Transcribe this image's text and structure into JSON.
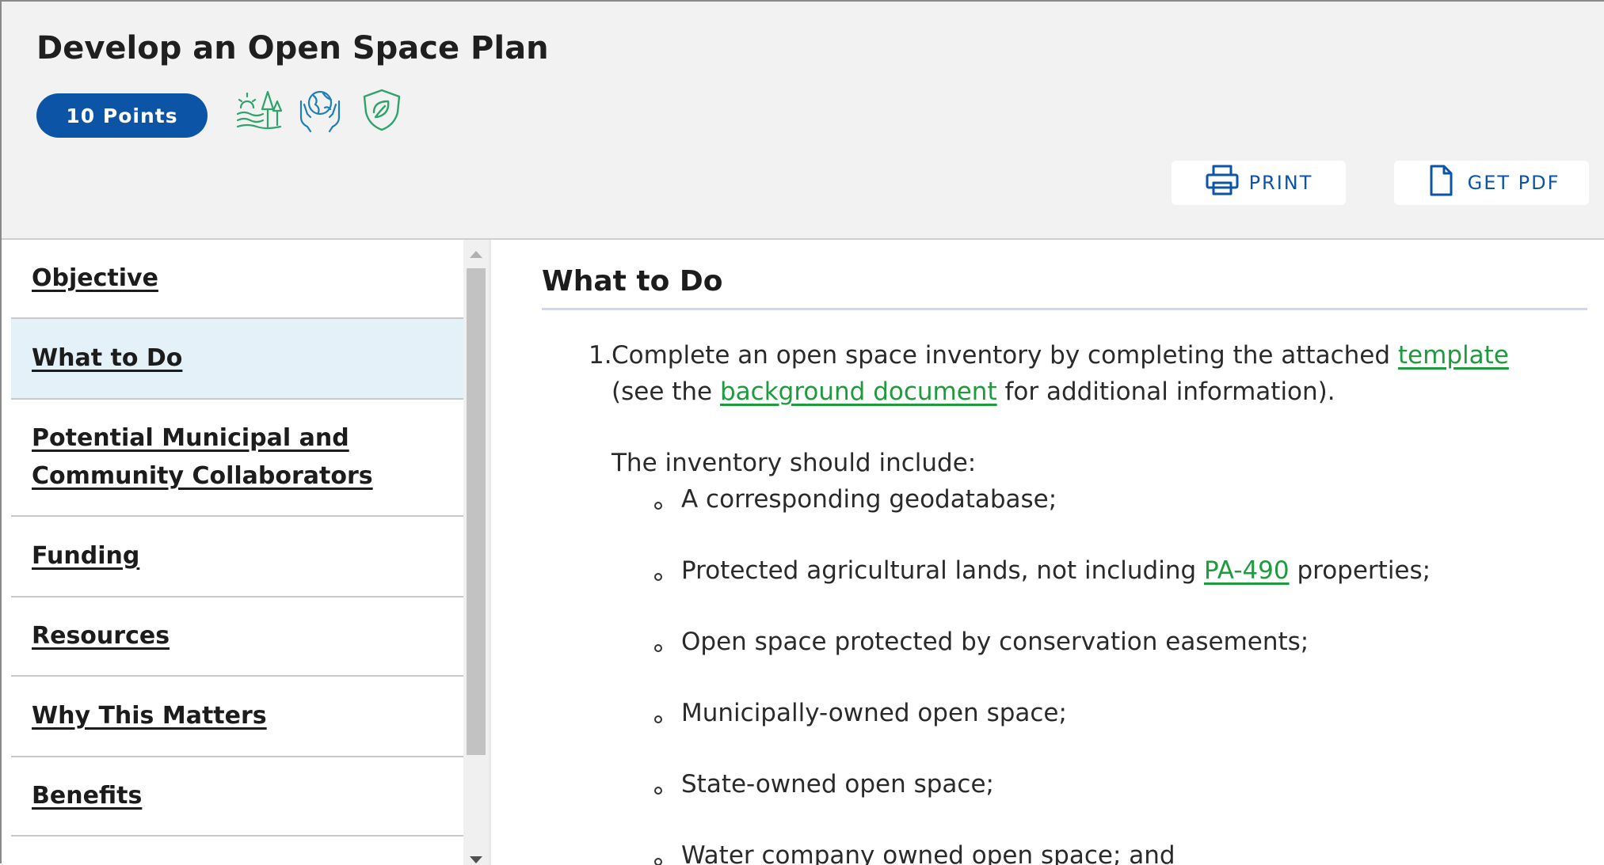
{
  "header": {
    "title": "Develop an Open Space Plan",
    "points_label": "10 Points",
    "category_icons": [
      "landscape-trees-icon",
      "hands-globe-icon",
      "shield-leaf-icon"
    ],
    "print_label": "PRINT",
    "pdf_label": "GET PDF"
  },
  "sidebar": {
    "items": [
      {
        "label": "Objective",
        "active": false
      },
      {
        "label": "What to Do",
        "active": true
      },
      {
        "label": "Potential Municipal and Community Collaborators",
        "line1": "Potential Municipal and",
        "line2": "Community Collaborators",
        "active": false
      },
      {
        "label": "Funding",
        "active": false
      },
      {
        "label": "Resources",
        "active": false
      },
      {
        "label": "Why This Matters",
        "active": false
      },
      {
        "label": "Benefits",
        "active": false
      }
    ]
  },
  "content": {
    "heading": "What to Do",
    "step1": {
      "number": "1.",
      "part1": "Complete an open space inventory by completing the attached ",
      "link1": "template",
      "part2": "(see the ",
      "link2": "background document",
      "part3": " for additional information)."
    },
    "intro": "The inventory should include:",
    "bullets": [
      {
        "text": "A corresponding geodatabase;"
      },
      {
        "before": "Protected agricultural lands, not including ",
        "link": "PA-490",
        "after": " properties;"
      },
      {
        "text": "Open space protected by conservation easements;"
      },
      {
        "text": "Municipally-owned open space;"
      },
      {
        "text": "State-owned open space;"
      },
      {
        "text": "Water company owned open space; and"
      }
    ]
  },
  "colors": {
    "brand_blue": "#0c55a6",
    "link_green": "#1f9a3e",
    "icon_green": "#2fa36b",
    "active_nav_bg": "#e4f1f9",
    "header_bg": "#f2f2f2"
  }
}
